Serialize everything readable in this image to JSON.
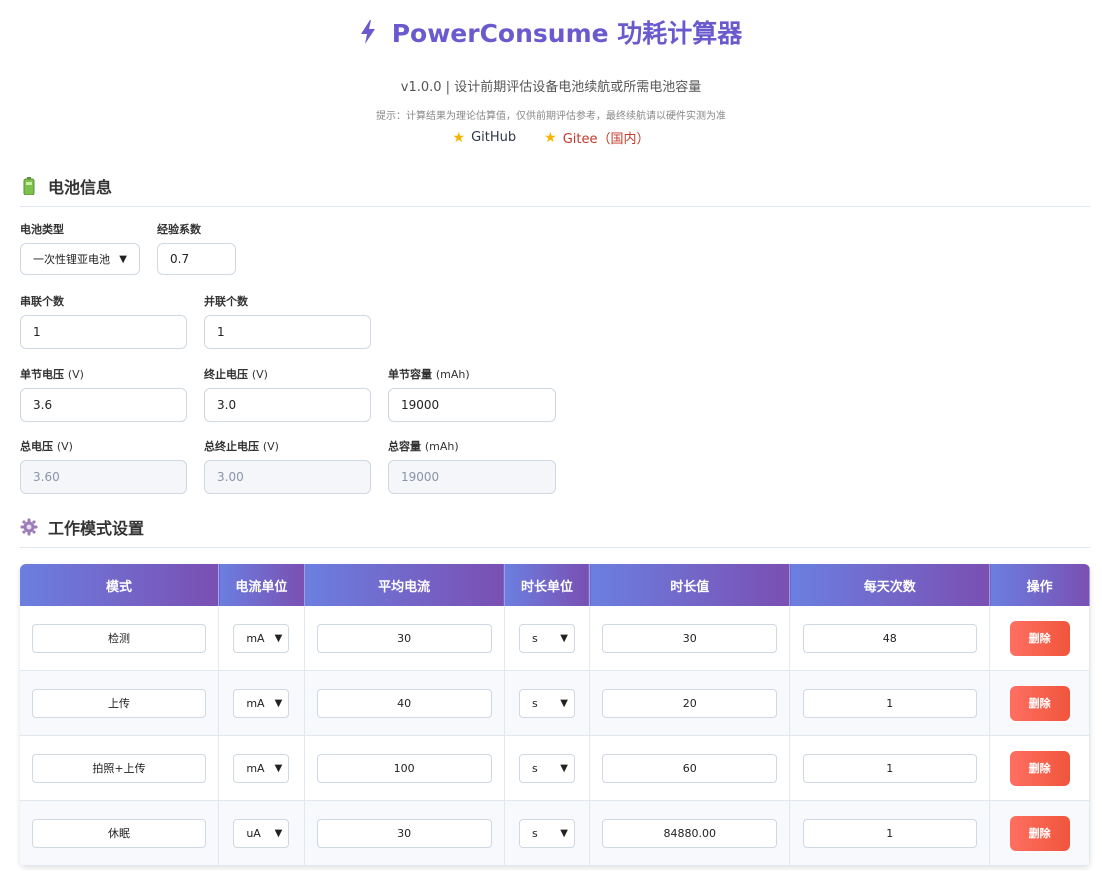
{
  "header": {
    "title": "PowerConsume 功耗计算器",
    "subtitle": "v1.0.0 | 设计前期评估设备电池续航或所需电池容量",
    "hint": "提示：计算结果为理论估算值，仅供前期评估参考，最终续航请以硬件实测为准",
    "links": [
      {
        "label": "GitHub",
        "icon": "star-icon"
      },
      {
        "label": "Gitee（国内）",
        "icon": "star-icon"
      }
    ]
  },
  "battery": {
    "section_title": "电池信息",
    "section_icon": "battery-icon",
    "type_label": "电池类型",
    "type_value": "一次性锂亚电池",
    "factor_label": "经验系数",
    "factor_value": "0.7",
    "series_label": "串联个数",
    "series_value": "1",
    "parallel_label": "并联个数",
    "parallel_value": "1",
    "cell_voltage_label": "单节电压",
    "cell_voltage_unit": "(V)",
    "cell_voltage_value": "3.6",
    "cutoff_voltage_label": "终止电压",
    "cutoff_voltage_unit": "(V)",
    "cutoff_voltage_value": "3.0",
    "cell_capacity_label": "单节容量",
    "cell_capacity_unit": "(mAh)",
    "cell_capacity_value": "19000",
    "total_voltage_label": "总电压",
    "total_voltage_unit": "(V)",
    "total_voltage_value": "3.60",
    "total_cutoff_label": "总终止电压",
    "total_cutoff_unit": "(V)",
    "total_cutoff_value": "3.00",
    "total_capacity_label": "总容量",
    "total_capacity_unit": "(mAh)",
    "total_capacity_value": "19000"
  },
  "modes": {
    "section_title": "工作模式设置",
    "section_icon": "gear-icon",
    "columns": [
      "模式",
      "电流单位",
      "平均电流",
      "时长单位",
      "时长值",
      "每天次数",
      "操作"
    ],
    "delete_label": "删除",
    "rows": [
      {
        "name": "检测",
        "current_unit": "mA",
        "current": "30",
        "time_unit": "s",
        "duration": "30",
        "per_day": "48"
      },
      {
        "name": "上传",
        "current_unit": "mA",
        "current": "40",
        "time_unit": "s",
        "duration": "20",
        "per_day": "1"
      },
      {
        "name": "拍照+上传",
        "current_unit": "mA",
        "current": "100",
        "time_unit": "s",
        "duration": "60",
        "per_day": "1"
      },
      {
        "name": "休眠",
        "current_unit": "uA",
        "current": "30",
        "time_unit": "s",
        "duration": "84880.00",
        "per_day": "1"
      }
    ]
  },
  "colors": {
    "title": "#6a5acd",
    "header_gradient_start": "#6b7fe0",
    "header_gradient_end": "#7a4fb2",
    "delete_button": "#f0553c",
    "gitee_link": "#c0392b"
  }
}
